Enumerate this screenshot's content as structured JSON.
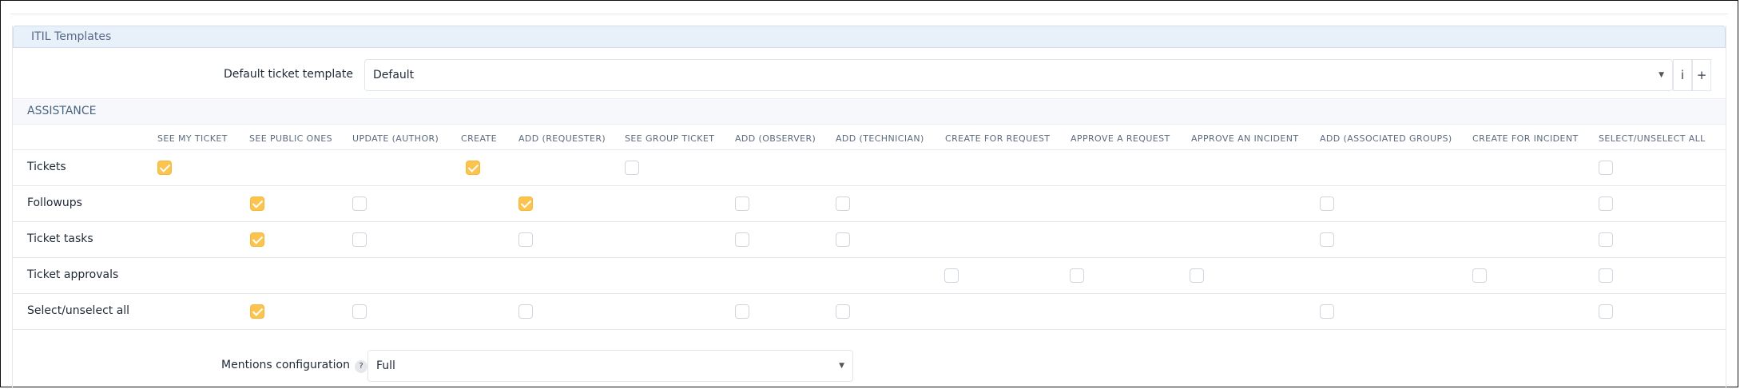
{
  "section": {
    "title": "ITIL Templates"
  },
  "default_template": {
    "label": "Default ticket template",
    "value": "Default",
    "info_icon": "info-icon",
    "add_icon": "plus-icon",
    "info_glyph": "i",
    "add_glyph": "+"
  },
  "assistance": {
    "title": "ASSISTANCE",
    "columns": [
      "SEE MY TICKET",
      "SEE PUBLIC ONES",
      "UPDATE (AUTHOR)",
      "CREATE",
      "ADD (REQUESTER)",
      "SEE GROUP TICKET",
      "ADD (OBSERVER)",
      "ADD (TECHNICIAN)",
      "CREATE FOR REQUEST",
      "APPROVE A REQUEST",
      "APPROVE AN INCIDENT",
      "ADD (ASSOCIATED GROUPS)",
      "CREATE FOR INCIDENT",
      "SELECT/UNSELECT ALL"
    ],
    "rows": [
      {
        "label": "Tickets",
        "cells": [
          true,
          null,
          null,
          true,
          null,
          false,
          null,
          null,
          null,
          null,
          null,
          null,
          null,
          false
        ]
      },
      {
        "label": "Followups",
        "cells": [
          null,
          true,
          false,
          null,
          true,
          null,
          false,
          false,
          null,
          null,
          null,
          false,
          null,
          false
        ]
      },
      {
        "label": "Ticket tasks",
        "cells": [
          null,
          true,
          false,
          null,
          false,
          null,
          false,
          false,
          null,
          null,
          null,
          false,
          null,
          false
        ]
      },
      {
        "label": "Ticket approvals",
        "cells": [
          null,
          null,
          null,
          null,
          null,
          null,
          null,
          null,
          false,
          false,
          false,
          null,
          false,
          false
        ]
      },
      {
        "label": "Select/unselect all",
        "cells": [
          null,
          true,
          false,
          null,
          false,
          null,
          false,
          false,
          null,
          null,
          null,
          false,
          null,
          false
        ]
      }
    ]
  },
  "mentions": {
    "label": "Mentions configuration",
    "help_icon": "question-icon",
    "help_glyph": "?",
    "value": "Full"
  },
  "colors": {
    "accent_checked": "#fcc44e",
    "header_bg": "#e8f0fa",
    "header_text": "#56688a"
  }
}
